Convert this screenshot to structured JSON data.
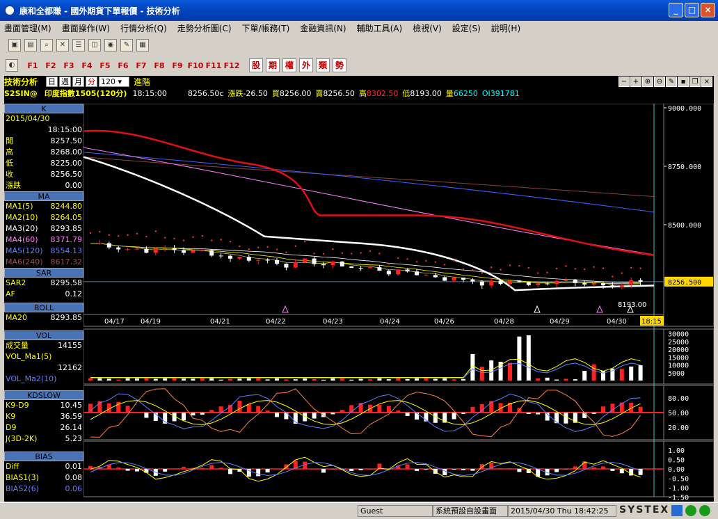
{
  "window": {
    "title": "康和全都賺 - 國外期貨下單報價 - 技術分析"
  },
  "menu": [
    "畫面管理(M)",
    "畫面操作(W)",
    "行情分析(Q)",
    "走勢分析圖(C)",
    "下單/帳務(T)",
    "金融資訊(N)",
    "輔助工具(A)",
    "檢視(V)",
    "設定(S)",
    "說明(H)"
  ],
  "fkeys": [
    "F1",
    "F2",
    "F3",
    "F4",
    "F5",
    "F6",
    "F7",
    "F8",
    "F9",
    "F10",
    "F11",
    "F12"
  ],
  "redbuttons": [
    "股",
    "期",
    "權",
    "外",
    "類",
    "勢"
  ],
  "chart_header": {
    "title": "技術分析",
    "periods": [
      "日",
      "週",
      "月",
      "分"
    ],
    "interval": "120",
    "advanced": "進階"
  },
  "quote": {
    "symbol": "S2SIN@",
    "name": "印度指數1505(120分)",
    "time": "18:15:00",
    "last": "8256.50c",
    "change_label": "漲跌",
    "change": "-26.50",
    "bid_label": "買",
    "bid": "8256.00",
    "ask_label": "賣",
    "ask": "8256.50",
    "high_label": "高",
    "high": "8302.50",
    "low_label": "低",
    "low": "8193.00",
    "vol_label": "量",
    "vol": "66250",
    "oi_label": "OI",
    "oi": "391781"
  },
  "panel": {
    "k": {
      "header": "K",
      "date": "2015/04/30",
      "time": "18:15:00",
      "rows": [
        {
          "l": "開",
          "v": "8257.50"
        },
        {
          "l": "高",
          "v": "8268.00"
        },
        {
          "l": "低",
          "v": "8225.00"
        },
        {
          "l": "收",
          "v": "8256.50"
        },
        {
          "l": "漲跌",
          "v": "0.00"
        }
      ]
    },
    "ma": {
      "header": "MA",
      "rows": [
        {
          "l": "MA1(5)",
          "v": "8244.80",
          "c": "#ffff00"
        },
        {
          "l": "MA2(10)",
          "v": "8264.05",
          "c": "#ffff00"
        },
        {
          "l": "MA3(20)",
          "v": "8293.85",
          "c": "#ffffff"
        },
        {
          "l": "MA4(60)",
          "v": "8371.79",
          "c": "#ff80ff"
        },
        {
          "l": "MA5(120)",
          "v": "8554.13",
          "c": "#6080ff"
        },
        {
          "l": "MA6(240)",
          "v": "8617.32",
          "c": "#a05050"
        }
      ]
    },
    "sar": {
      "header": "SAR",
      "rows": [
        {
          "l": "SAR2",
          "v": "8295.58"
        },
        {
          "l": "AF",
          "v": "0.12"
        }
      ]
    },
    "boll": {
      "header": "BOLL",
      "rows": [
        {
          "l": "MA20",
          "v": "8293.85"
        }
      ]
    },
    "vol": {
      "header": "VOL",
      "rows": [
        {
          "l": "成交量",
          "v": "14155"
        },
        {
          "l": "VOL_Ma1(5)",
          "v": ""
        },
        {
          "l": "",
          "v": "12162"
        },
        {
          "l": "VOL_Ma2(10)",
          "v": ""
        }
      ]
    },
    "kd": {
      "header": "KDSLOW",
      "rows": [
        {
          "l": "K9-D9",
          "v": "10.45"
        },
        {
          "l": "K9",
          "v": "36.59"
        },
        {
          "l": "D9",
          "v": "26.14"
        },
        {
          "l": "J(3D-2K)",
          "v": "5.23"
        }
      ]
    },
    "bias": {
      "header": "BIAS",
      "rows": [
        {
          "l": "Diff",
          "v": "0.01"
        },
        {
          "l": "BIAS1(3)",
          "v": "0.08"
        },
        {
          "l": "BIAS2(6)",
          "v": "0.06"
        }
      ]
    }
  },
  "axis": {
    "price_ticks": [
      "9000.000",
      "8750.000",
      "8500.000"
    ],
    "current_price": "8256.500",
    "low_marker": "8193.00",
    "dates": [
      "04/17",
      "04/19",
      "04/21",
      "04/22",
      "04/23",
      "04/24",
      "04/26",
      "04/28",
      "04/29",
      "04/30"
    ],
    "time_cursor": "18:15",
    "vol_ticks": [
      "30000",
      "25000",
      "20000",
      "15000",
      "10000",
      "5000"
    ],
    "kd_ticks": [
      "80.00",
      "50.00",
      "20.00"
    ],
    "bias_ticks": [
      "1.00",
      "0.50",
      "0.00",
      "-0.50",
      "-1.00",
      "-1.50"
    ]
  },
  "status": {
    "user": "Guest",
    "layout": "系統預設自設畫面",
    "datetime": "2015/04/30 Thu 18:42:25",
    "brand": "SYSTEX"
  }
}
